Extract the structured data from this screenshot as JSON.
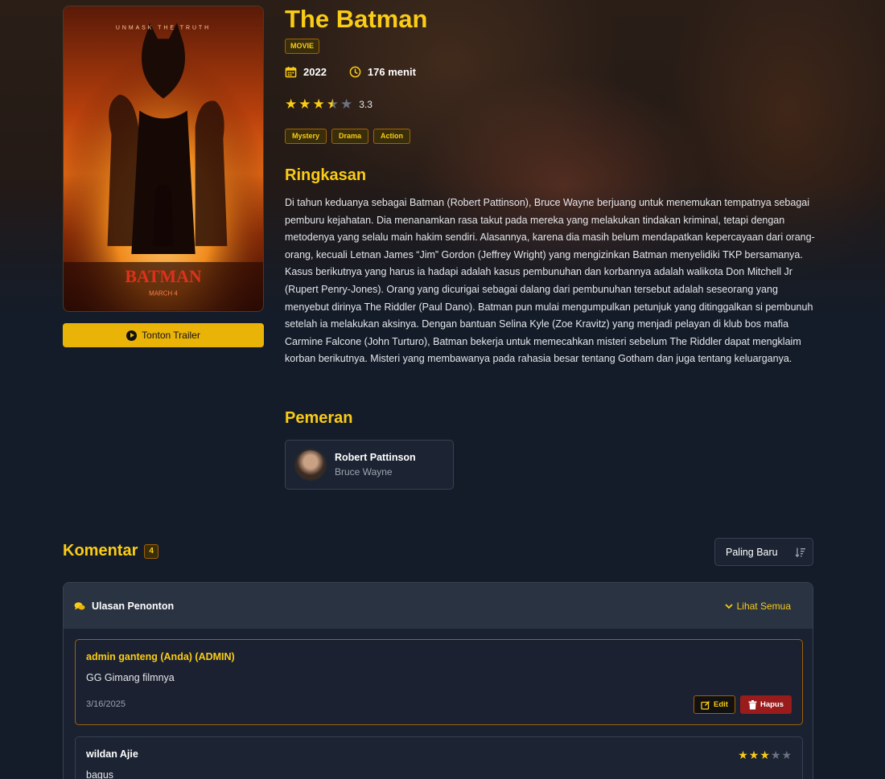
{
  "movie": {
    "title": "The Batman",
    "type_badge": "MOVIE",
    "year": "2022",
    "duration": "176 menit",
    "rating_value": "3.3",
    "rating": 3.3,
    "genres": [
      "Mystery",
      "Drama",
      "Action"
    ],
    "trailer_label": "Tonton Trailer",
    "poster_texts": {
      "tagline": "UNMASK THE TRUTH",
      "logo": "BATMAN",
      "release": "MARCH 4"
    }
  },
  "synopsis": {
    "heading": "Ringkasan",
    "text": "Di tahun keduanya sebagai Batman (Robert Pattinson), Bruce Wayne berjuang untuk menemukan tempatnya sebagai pemburu kejahatan. Dia menanamkan rasa takut pada mereka yang melakukan tindakan kriminal, tetapi dengan metodenya yang selalu main hakim sendiri. Alasannya, karena dia masih belum mendapatkan kepercayaan dari orang-orang, kecuali Letnan James “Jim” Gordon (Jeffrey Wright) yang mengizinkan Batman menyelidiki TKP bersamanya. Kasus berikutnya yang harus ia hadapi adalah kasus pembunuhan dan korbannya adalah walikota Don Mitchell Jr (Rupert Penry-Jones). Orang yang dicurigai sebagai dalang dari pembunuhan tersebut adalah seseorang yang menyebut dirinya The Riddler (Paul Dano). Batman pun mulai mengumpulkan petunjuk yang ditinggalkan si pembunuh setelah ia melakukan aksinya. Dengan bantuan Selina Kyle (Zoe Kravitz) yang menjadi pelayan di klub bos mafia Carmine Falcone (John Turturo), Batman bekerja untuk memecahkan misteri sebelum The Riddler dapat mengklaim korban berikutnya. Misteri yang membawanya pada rahasia besar tentang Gotham dan juga tentang keluarganya."
  },
  "cast": {
    "heading": "Pemeran",
    "members": [
      {
        "name": "Robert Pattinson",
        "role": "Bruce Wayne"
      }
    ]
  },
  "comments": {
    "heading": "Komentar",
    "count": "4",
    "sort_label": "Paling Baru",
    "panel_title": "Ulasan Penonton",
    "see_all_label": "Lihat Semua",
    "items": [
      {
        "author": "admin ganteng (Anda) (ADMIN)",
        "text": "GG Gimang filmnya",
        "date": "3/16/2025",
        "edit_label": "Edit",
        "delete_label": "Hapus"
      },
      {
        "author": "wildan Ajie",
        "text": "bagus",
        "rating": 3
      }
    ]
  },
  "colors": {
    "accent": "#facc15",
    "danger": "#991b1b",
    "background": "#151c29"
  }
}
